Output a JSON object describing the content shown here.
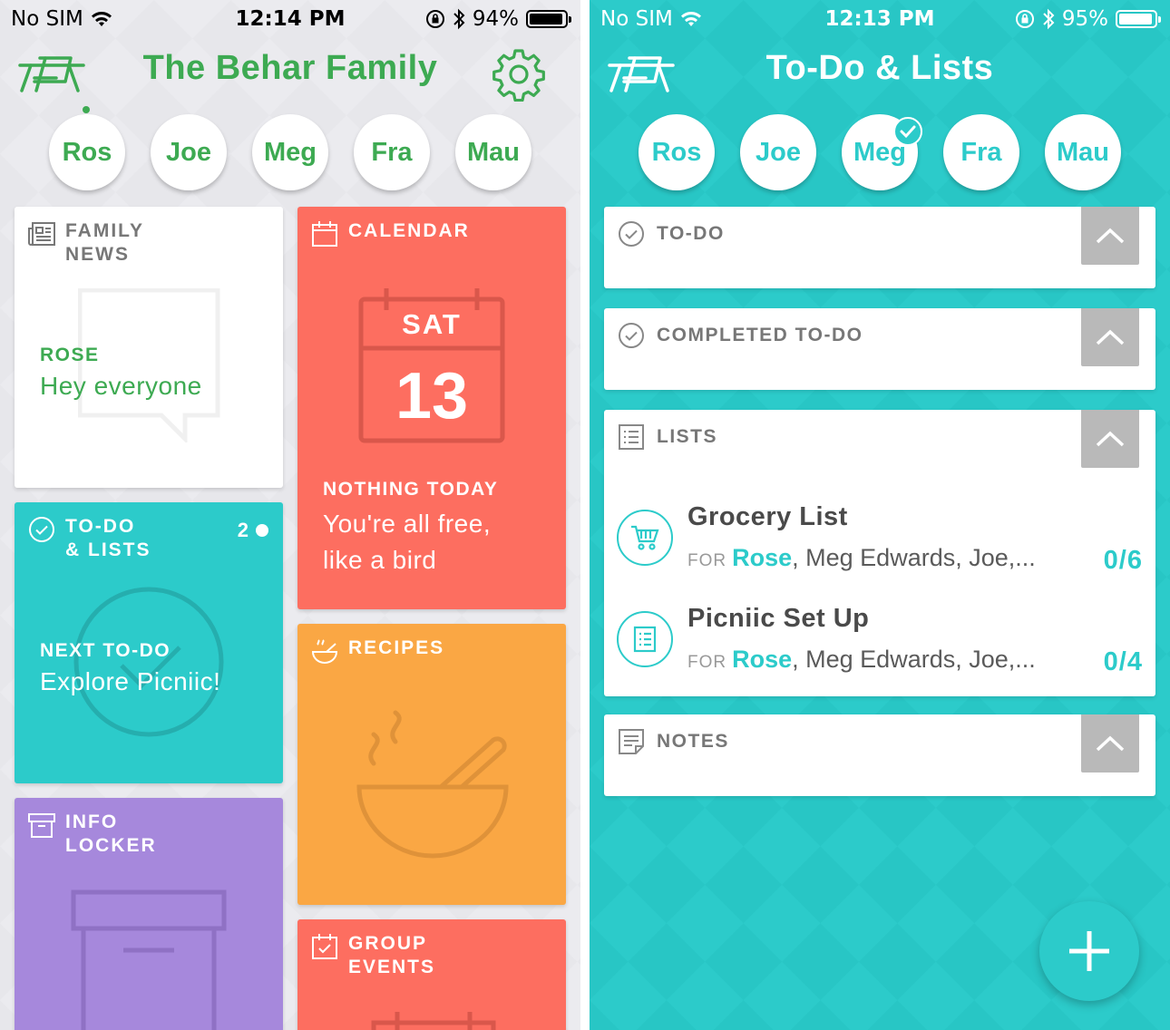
{
  "left_screen": {
    "status_bar": {
      "carrier": "No SIM",
      "time": "12:14 PM",
      "battery": "94%"
    },
    "header": {
      "title": "The Behar Family",
      "logo_icon": "picniic-logo-icon",
      "settings_icon": "gear-icon"
    },
    "members": [
      "Ros",
      "Joe",
      "Meg",
      "Fra",
      "Mau"
    ],
    "tiles": {
      "family_news": {
        "label": "FAMILY\nNEWS",
        "author": "ROSE",
        "message": "Hey everyone"
      },
      "calendar": {
        "label": "CALENDAR",
        "day_name": "SAT",
        "day_number": "13",
        "status_title": "NOTHING TODAY",
        "status_text": "You're all free,\nlike a bird"
      },
      "todo": {
        "label": "TO-DO\n& LISTS",
        "count": "2",
        "next_title": "NEXT TO-DO",
        "next_text": "Explore Picniic!"
      },
      "recipes": {
        "label": "RECIPES"
      },
      "info_locker": {
        "label": "INFO\nLOCKER"
      },
      "group_events": {
        "label": "GROUP\nEVENTS"
      }
    },
    "colors": {
      "brand_green": "#3daa52",
      "calendar_red": "#fd6e60",
      "todo_teal": "#2ccbca",
      "recipes_orange": "#faa744",
      "locker_purple": "#a688dc",
      "events_red": "#fd6e60"
    }
  },
  "right_screen": {
    "status_bar": {
      "carrier": "No SIM",
      "time": "12:13 PM",
      "battery": "95%"
    },
    "header": {
      "title": "To-Do & Lists"
    },
    "members": [
      "Ros",
      "Joe",
      "Meg",
      "Fra",
      "Mau"
    ],
    "selected_member": "Meg",
    "sections": {
      "todo": {
        "title": "TO-DO"
      },
      "completed": {
        "title": "COMPLETED TO-DO"
      },
      "lists": {
        "title": "LISTS"
      },
      "notes": {
        "title": "NOTES"
      }
    },
    "lists": [
      {
        "name": "Grocery List",
        "for_label": "FOR",
        "owner": "Rose",
        "others": ", Meg Edwards, Joe,...",
        "count": "0/6",
        "icon": "shopping-cart-icon"
      },
      {
        "name": "Picniic Set Up",
        "for_label": "FOR",
        "owner": "Rose",
        "others": ", Meg Edwards, Joe,...",
        "count": "0/4",
        "icon": "list-document-icon"
      }
    ],
    "fab_icon": "plus-icon",
    "colors": {
      "teal": "#2ccbca",
      "collapse_button": "#b9b9b9"
    }
  }
}
